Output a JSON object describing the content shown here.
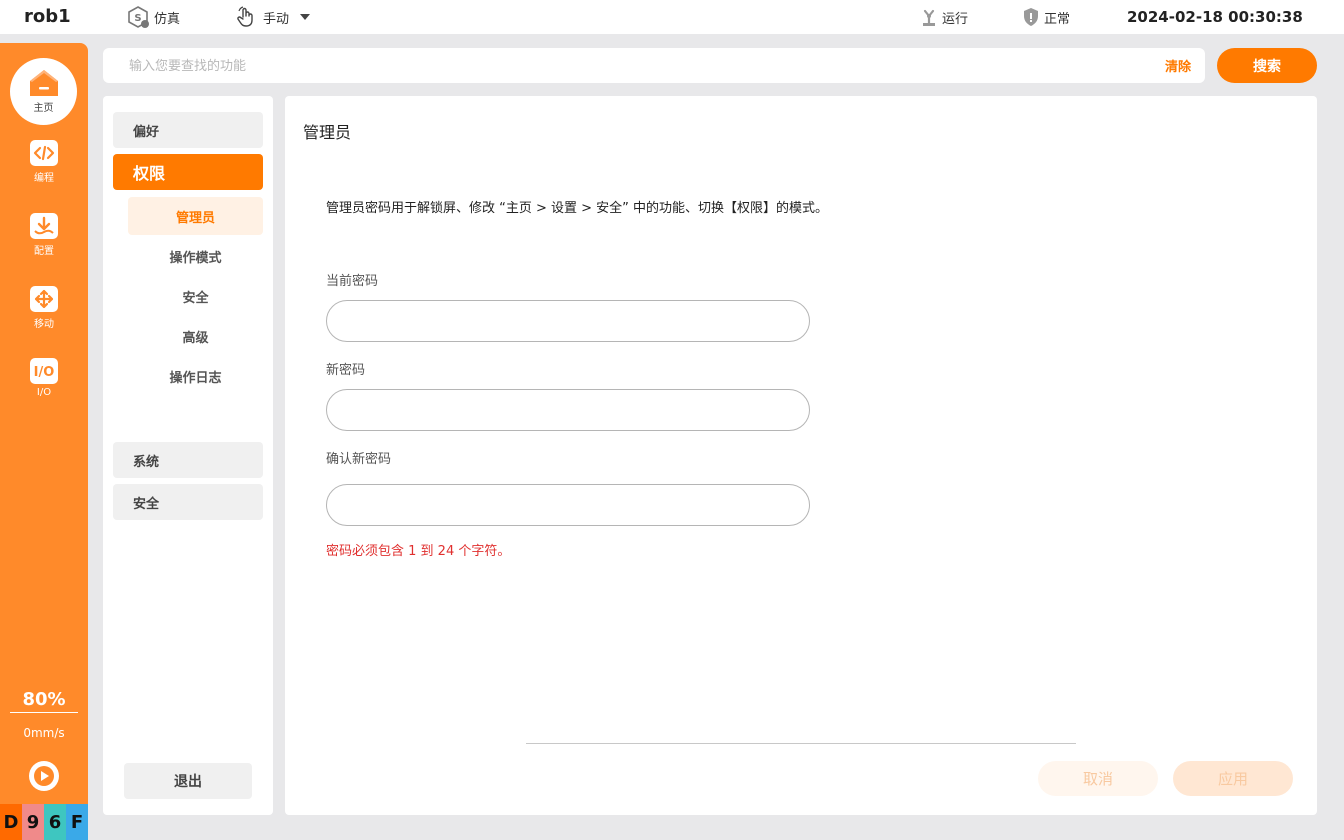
{
  "topbar": {
    "robot_name": "rob1",
    "sim_label": "仿真",
    "mode_label": "手动",
    "run_label": "运行",
    "status_label": "正常",
    "datetime": "2024-02-18 00:30:38"
  },
  "sidebar": {
    "home_label": "主页",
    "items": [
      {
        "label": "编程",
        "icon": "code-icon"
      },
      {
        "label": "配置",
        "icon": "config-download-icon"
      },
      {
        "label": "移动",
        "icon": "move-arrows-icon"
      },
      {
        "label": "I/O",
        "icon": "io-icon"
      }
    ],
    "speed_percent": "80%",
    "speed_value": "0mm/s",
    "code_chars": [
      "D",
      "9",
      "6",
      "F"
    ],
    "code_colors": [
      "#ff6a00",
      "#f08a8a",
      "#3ec6c0",
      "#3aa9e8"
    ]
  },
  "search": {
    "placeholder": "输入您要查找的功能",
    "clear_label": "清除",
    "button_label": "搜索"
  },
  "menu": {
    "preferences": "偏好",
    "permissions": "权限",
    "sub_items": [
      "管理员",
      "操作模式",
      "安全",
      "高级",
      "操作日志"
    ],
    "system": "系统",
    "safety": "安全",
    "logout": "退出"
  },
  "content": {
    "title": "管理员",
    "description": "管理员密码用于解锁屏、修改 “主页 > 设置 > 安全” 中的功能、切换【权限】的模式。",
    "current_password_label": "当前密码",
    "new_password_label": "新密码",
    "confirm_password_label": "确认新密码",
    "current_password_value": "",
    "new_password_value": "",
    "confirm_password_value": "",
    "error_message": "密码必须包含 1 到 24 个字符。",
    "cancel_label": "取消",
    "apply_label": "应用"
  },
  "colors": {
    "accent": "#ff7a00",
    "sidebar": "#ff8a2a",
    "error": "#e0302f"
  }
}
